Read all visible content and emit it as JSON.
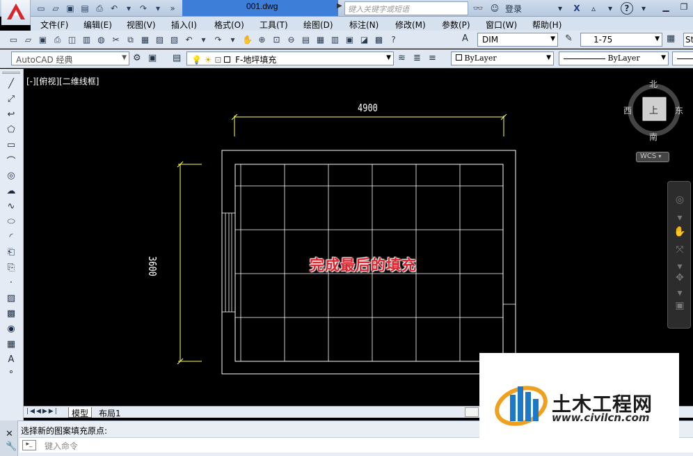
{
  "title_bar": {
    "doc_title": "001.dwg",
    "search_placeholder": "键入关键字或短语",
    "login_label": "登录",
    "help_glyph": "?"
  },
  "menu": {
    "items": [
      "文件(F)",
      "编辑(E)",
      "视图(V)",
      "插入(I)",
      "格式(O)",
      "工具(T)",
      "绘图(D)",
      "标注(N)",
      "修改(M)",
      "参数(P)",
      "窗口(W)",
      "帮助(H)"
    ]
  },
  "toolbar1": {
    "dim_style": "DIM",
    "scale": "1-75",
    "text_style_partial": "St"
  },
  "toolbar2": {
    "workspace": "AutoCAD 经典",
    "layer": "F-地坪填充",
    "color": "ByLayer",
    "linetype": "ByLayer"
  },
  "viewport": {
    "view_label": "[-][俯视][二维线框]"
  },
  "viewcube": {
    "north": "北",
    "south": "南",
    "east": "东",
    "west": "西",
    "top_face": "上",
    "wcs": "WCS"
  },
  "drawing": {
    "dim_width": "4900",
    "dim_height": "3600",
    "caption": "完成最后的填充"
  },
  "tabs": {
    "model": "模型",
    "layout1": "布局1"
  },
  "command": {
    "last_output": "选择新的图案填充原点:",
    "input_placeholder": "键入命令"
  },
  "watermark": {
    "cn_name": "土木工程网",
    "url": "www.civilcn.com"
  },
  "colors": {
    "canvas": "#000000",
    "geometry": "#ffffff",
    "dimension": "#ffff66",
    "caption": "#e0202a",
    "title_accent": "#3d7fd8"
  }
}
